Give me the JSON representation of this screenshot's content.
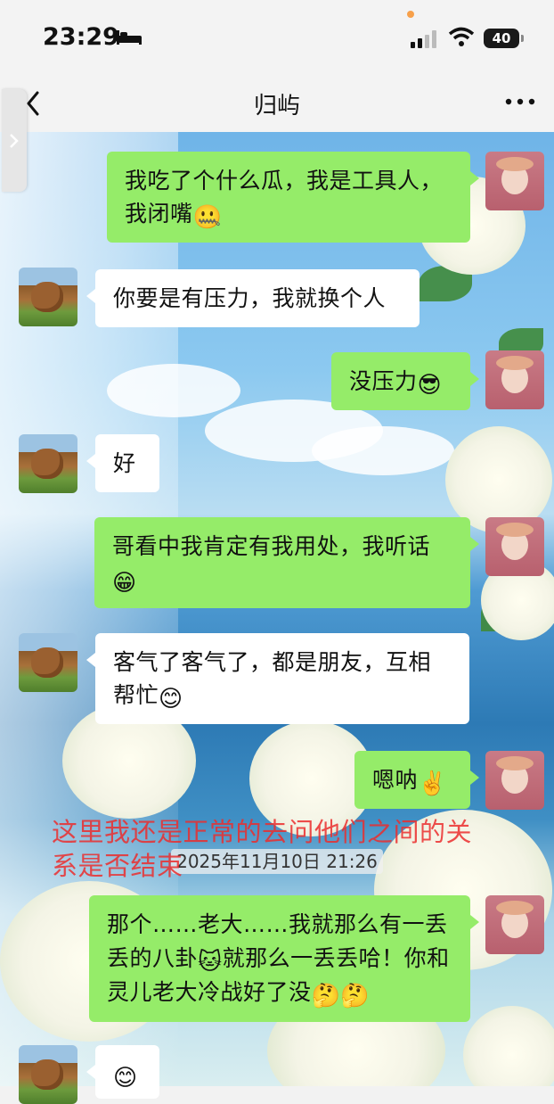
{
  "status_bar": {
    "time": "23:29",
    "battery": "40"
  },
  "nav": {
    "title": "归屿"
  },
  "messages": [
    {
      "from": "me",
      "text": "我吃了个什么瓜，我是工具人，我闭嘴",
      "emoji": "🤐"
    },
    {
      "from": "friend",
      "text": "你要是有压力，我就换个人",
      "emoji": ""
    },
    {
      "from": "me",
      "text": "没压力",
      "emoji": "😎"
    },
    {
      "from": "friend",
      "text": "好",
      "emoji": ""
    },
    {
      "from": "me",
      "text": "哥看中我肯定有我用处，我听话",
      "emoji": "😁"
    },
    {
      "from": "friend",
      "text": "客气了客气了，都是朋友，互相帮忙",
      "emoji": "😊"
    },
    {
      "from": "me",
      "text": "嗯呐",
      "emoji": "✌️"
    },
    {
      "from": "me",
      "text": "那个……老大……我就那么有一丢丢的八卦",
      "text_after": "就那么一丢丢哈！你和灵儿老大冷战好了没",
      "emoji_mid": "🐱",
      "emoji": "🤔🤔"
    },
    {
      "from": "friend",
      "text": "",
      "emoji": "😊"
    }
  ],
  "timestamp": "2025年11月10日 21:26",
  "annotation": "这里我还是正常的去问他们之间的关系是否结束",
  "colors": {
    "me_bubble": "#95ec69",
    "friend_bubble": "#ffffff",
    "annotation": "#eb2d2d"
  }
}
